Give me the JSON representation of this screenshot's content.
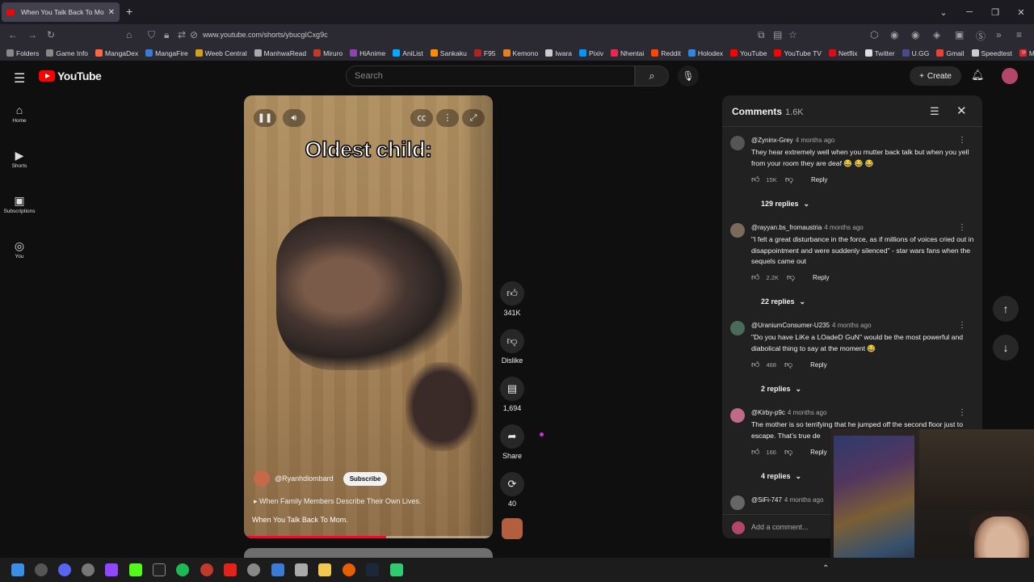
{
  "browser": {
    "tab_title": "When You Talk Back To Mo",
    "new_tab": "+",
    "url": "www.youtube.com/shorts/ybucgICxg9c",
    "bookmarks": [
      {
        "label": "Folders",
        "color": "#888888"
      },
      {
        "label": "Game Info",
        "color": "#888888"
      },
      {
        "label": "MangaDex",
        "color": "#ff6740"
      },
      {
        "label": "MangaFire",
        "color": "#3a7bd5"
      },
      {
        "label": "Weeb Central",
        "color": "#d4a017"
      },
      {
        "label": "ManhwaRead",
        "color": "#aaaaaa"
      },
      {
        "label": "Miruro",
        "color": "#c0392b"
      },
      {
        "label": "HiAnime",
        "color": "#8e44ad"
      },
      {
        "label": "AniList",
        "color": "#02a9ff"
      },
      {
        "label": "Sankaku",
        "color": "#ff8c00"
      },
      {
        "label": "F95",
        "color": "#b22222"
      },
      {
        "label": "Kemono",
        "color": "#e67e22"
      },
      {
        "label": "Iwara",
        "color": "#cccccc"
      },
      {
        "label": "Pixiv",
        "color": "#0096fa"
      },
      {
        "label": "Nhentai",
        "color": "#ed2553"
      },
      {
        "label": "Reddit",
        "color": "#ff4500"
      },
      {
        "label": "Holodex",
        "color": "#2e86de"
      },
      {
        "label": "YouTube",
        "color": "#ff0000"
      },
      {
        "label": "YouTube TV",
        "color": "#ff0000"
      },
      {
        "label": "Netflix",
        "color": "#e50914"
      },
      {
        "label": "Twitter",
        "color": "#dddddd"
      },
      {
        "label": "U.GG",
        "color": "#4a4a8a"
      },
      {
        "label": "Gmail",
        "color": "#ea4335"
      },
      {
        "label": "Speedtest",
        "color": "#cccccc"
      },
      {
        "label": "MEGA",
        "color": "#d9272e"
      }
    ]
  },
  "header": {
    "logo_text": "YouTube",
    "search_placeholder": "Search",
    "create_label": "Create"
  },
  "sidebar": {
    "items": [
      {
        "label": "Home",
        "icon": "home-icon"
      },
      {
        "label": "Shorts",
        "icon": "shorts-icon"
      },
      {
        "label": "Subscriptions",
        "icon": "subscriptions-icon"
      },
      {
        "label": "You",
        "icon": "you-icon"
      }
    ]
  },
  "video": {
    "caption": "Oldest child:",
    "channel": "@Ryanhdlombard",
    "subscribe_label": "Subscribe",
    "music": "When Family Members Describe Their Own Lives.",
    "title": "When You Talk Back To Mom."
  },
  "actions": {
    "likes": "341K",
    "dislike_label": "Dislike",
    "comments": "1,694",
    "share_label": "Share",
    "remix": "40"
  },
  "comments": {
    "title": "Comments",
    "count": "1.6K",
    "add_placeholder": "Add a comment...",
    "reply_label": "Reply",
    "items": [
      {
        "user": "@Zyninx-Grey",
        "ago": "4 months ago",
        "text": "They hear extremely well when you mutter back talk but when you yell from your room they are deaf 😂 😂 😂",
        "likes": "15K",
        "replies": "129 replies",
        "avatar_color": "#555555"
      },
      {
        "user": "@rayyan.bs_fromaustria",
        "ago": "4 months ago",
        "text": "\"I felt a great disturbance in the force, as if millions of voices cried out in disappointment and were suddenly silenced\" - star wars fans when the sequels came out",
        "likes": "2.2K",
        "replies": "22 replies",
        "avatar_color": "#7a6a5a"
      },
      {
        "user": "@UraniumConsumer-U235",
        "ago": "4 months ago",
        "text": "\"Do you have LiKe a LOadeD GuN\" would be the most powerful and diabolical thing to say at the moment 😂",
        "likes": "468",
        "replies": "2 replies",
        "avatar_color": "#4a6a5a"
      },
      {
        "user": "@Kirby-p9c",
        "ago": "4 months ago",
        "text": "The mother is so terrifying that he jumped off the second floor just to escape. That's true de",
        "likes": "166",
        "replies": "4 replies",
        "avatar_color": "#c06a8a"
      },
      {
        "user": "@SiFi-747",
        "ago": "4 months ago",
        "text": "",
        "likes": "",
        "replies": "",
        "avatar_color": "#666666"
      }
    ]
  },
  "progress": 0.57
}
